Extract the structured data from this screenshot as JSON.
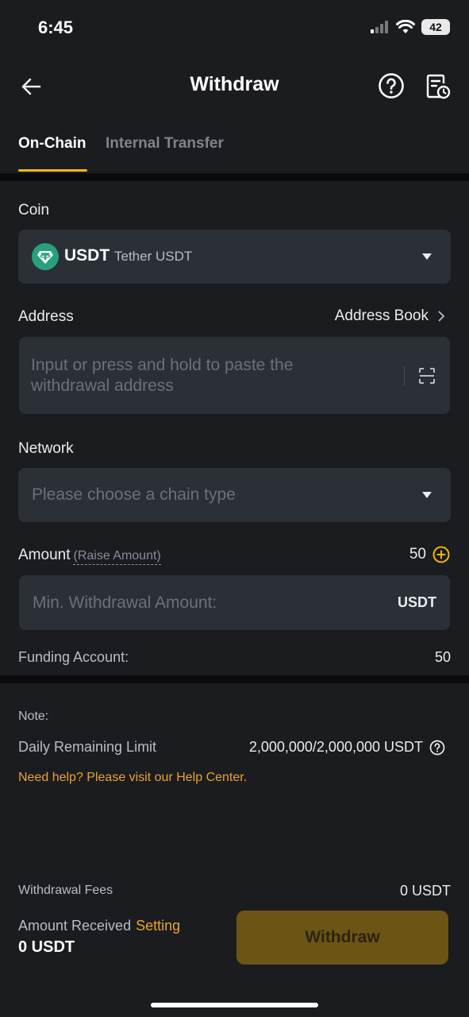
{
  "status": {
    "time": "6:45",
    "battery": "42"
  },
  "header": {
    "title": "Withdraw"
  },
  "tabs": [
    {
      "label": "On-Chain"
    },
    {
      "label": "Internal Transfer"
    }
  ],
  "coin": {
    "label": "Coin",
    "symbol": "USDT",
    "name": "Tether USDT"
  },
  "address": {
    "label": "Address",
    "book_link": "Address Book",
    "placeholder_line1": "Input or press and hold to paste the",
    "placeholder_line2": "withdrawal address"
  },
  "network": {
    "label": "Network",
    "placeholder": "Please choose a chain type"
  },
  "amount": {
    "label": "Amount",
    "raise_link": "(Raise Amount)",
    "limit_value": "50",
    "placeholder": "Min. Withdrawal Amount:",
    "unit": "USDT"
  },
  "funding": {
    "label": "Funding Account:",
    "value": "50"
  },
  "note": {
    "title": "Note:",
    "daily_label": "Daily Remaining Limit",
    "daily_value": "2,000,000/2,000,000 USDT",
    "help_text": "Need help? Please visit our Help Center."
  },
  "footer": {
    "fees_label": "Withdrawal Fees",
    "fees_value": "0 USDT",
    "received_label": "Amount Received",
    "setting_link": "Setting",
    "received_value": "0 USDT",
    "withdraw_button": "Withdraw"
  },
  "colors": {
    "accent": "#f0b90b",
    "field_bg": "#2b2f36",
    "tether": "#26a17b"
  }
}
